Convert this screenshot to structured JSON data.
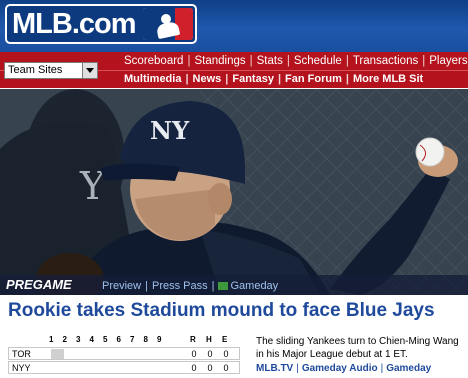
{
  "header": {
    "logo_text": "MLB.com"
  },
  "nav": {
    "primary": [
      "Scoreboard",
      "Standings",
      "Stats",
      "Schedule",
      "Transactions",
      "Players"
    ],
    "secondary": [
      "Multimedia",
      "News",
      "Fantasy",
      "Fan Forum",
      "More MLB Sit"
    ],
    "team_select_value": "Team Sites"
  },
  "hero": {
    "badge": "PREGAME",
    "links": [
      "Preview",
      "Press Pass",
      "Gameday"
    ]
  },
  "story": {
    "headline": "Rookie takes Stadium mound to face Blue Jays",
    "blurb": "The sliding Yankees turn to Chien-Ming Wang in his Major League debut at 1 ET.",
    "links": [
      "MLB.TV",
      "Gameday Audio",
      "Gameday"
    ]
  },
  "linescore": {
    "innings": [
      "1",
      "2",
      "3",
      "4",
      "5",
      "6",
      "7",
      "8",
      "9"
    ],
    "totals_headers": [
      "R",
      "H",
      "E"
    ],
    "rows": [
      {
        "team": "TOR",
        "totals": [
          "0",
          "0",
          "0"
        ]
      },
      {
        "team": "NYY",
        "totals": [
          "0",
          "0",
          "0"
        ]
      }
    ]
  },
  "colors": {
    "header_blue": "#1f58ad",
    "nav_red": "#b4121c",
    "headline_blue": "#1f4a9c"
  }
}
